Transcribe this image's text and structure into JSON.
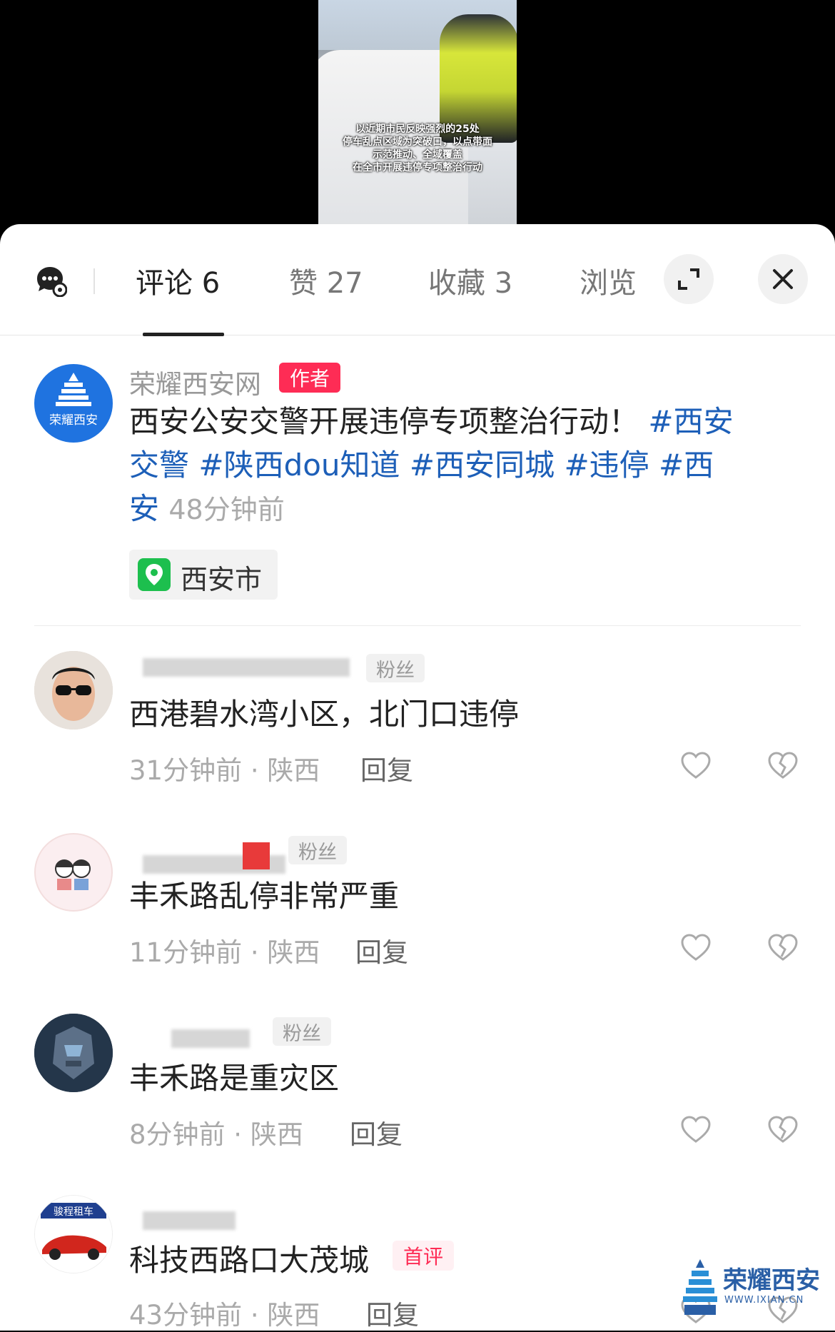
{
  "video": {
    "caption_lines": [
      "以近期市民反映强烈的25处",
      "停车乱点区域为突破口，以点带面",
      "示范推动、全域覆盖",
      "在全市开展违停专项整治行动"
    ]
  },
  "tabs": {
    "comments": "评论 6",
    "likes": "赞 27",
    "favorites": "收藏 3",
    "views": "浏览"
  },
  "post": {
    "author": "荣耀西安网",
    "author_badge": "作者",
    "text": "西安公安交警开展违停专项整治行动！",
    "tags": [
      "#西安交警",
      "#陕西dou知道",
      "#西安同城",
      "#违停",
      "#西安"
    ],
    "time": "48分钟前",
    "location": "西安市",
    "avatar_text": "荣耀西安"
  },
  "comments": [
    {
      "badge": "粉丝",
      "text": "西港碧水湾小区，北门口违停",
      "meta": "31分钟前 · 陕西",
      "reply": "回复"
    },
    {
      "badge": "粉丝",
      "text": "丰禾路乱停非常严重",
      "meta": "11分钟前 · 陕西",
      "reply": "回复"
    },
    {
      "badge": "粉丝",
      "text": "丰禾路是重灾区",
      "meta": "8分钟前 · 陕西",
      "reply": "回复"
    },
    {
      "badge": "首评",
      "text": "科技西路口大茂城",
      "meta": "43分钟前 · 陕西",
      "reply": "回复",
      "avatar_text": "骏程租车"
    }
  ],
  "watermark": {
    "text": "荣耀西安",
    "url": "WWW.IXIAN.CN"
  },
  "icons": {
    "chat": "chat-settings-icon",
    "expand": "expand-icon",
    "close": "close-icon",
    "like": "heart-icon",
    "dislike": "broken-heart-icon",
    "pin": "location-pin-icon"
  },
  "colors": {
    "accent": "#fe2c55",
    "tag": "#1d5fb8",
    "location_green": "#1dbf4e"
  }
}
